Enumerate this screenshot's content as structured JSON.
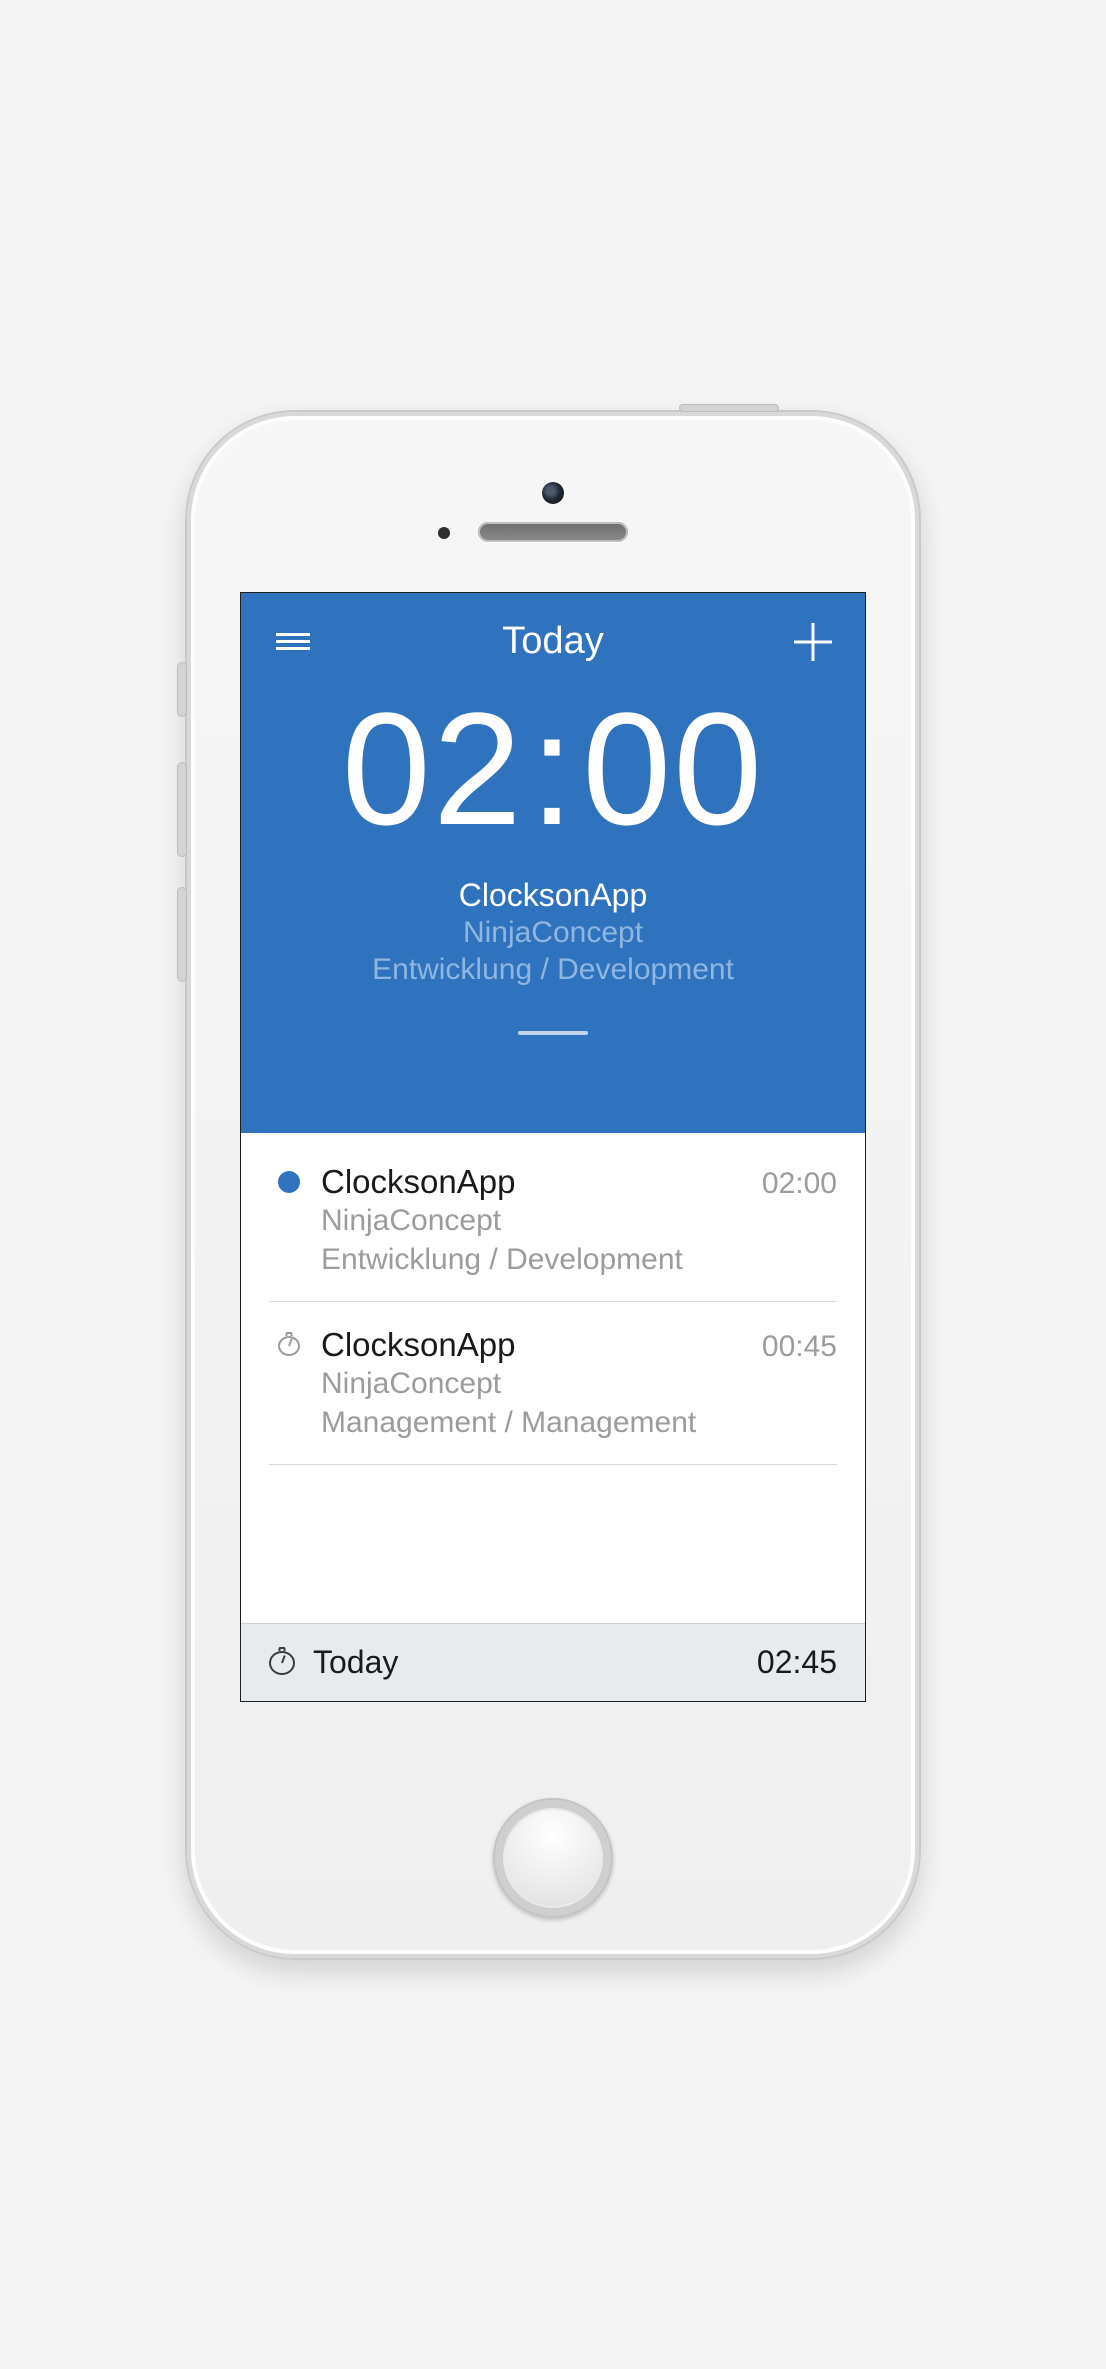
{
  "header": {
    "title": "Today",
    "timer": {
      "hh": "02",
      "mm": "00"
    },
    "project": "ClocksonApp",
    "client": "NinjaConcept",
    "category": "Entwicklung / Development"
  },
  "entries": [
    {
      "status": "active",
      "name": "ClocksonApp",
      "client": "NinjaConcept",
      "category": "Entwicklung / Development",
      "time": "02:00"
    },
    {
      "status": "idle",
      "name": "ClocksonApp",
      "client": "NinjaConcept",
      "category": "Management / Management",
      "time": "00:45"
    }
  ],
  "footer": {
    "label": "Today",
    "total": "02:45"
  }
}
